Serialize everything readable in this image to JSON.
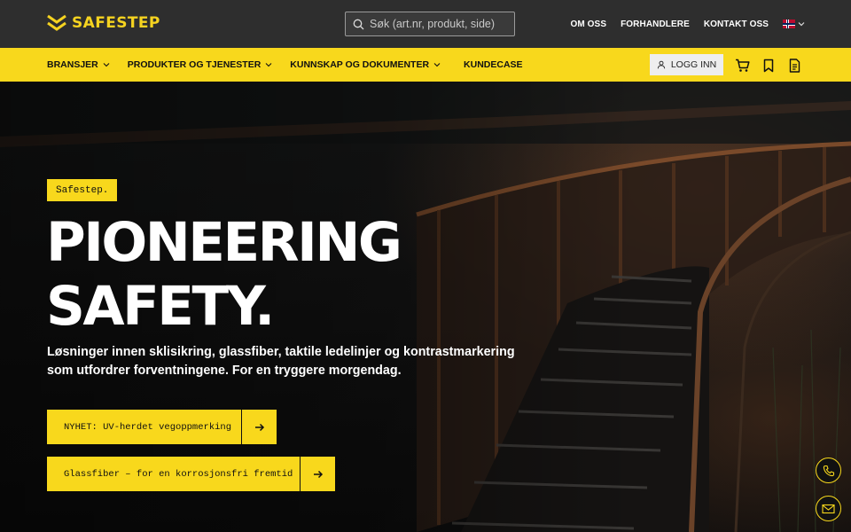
{
  "header": {
    "logo_text": "SAFESTEP",
    "search_placeholder": "Søk (art.nr, produkt, side)",
    "links": [
      "OM OSS",
      "FORHANDLERE",
      "KONTAKT OSS"
    ],
    "language_flag": "norway-flag-icon"
  },
  "nav": {
    "items": [
      {
        "label": "BRANSJER",
        "dropdown": true
      },
      {
        "label": "PRODUKTER OG TJENESTER",
        "dropdown": true
      },
      {
        "label": "KUNNSKAP OG DOKUMENTER",
        "dropdown": true
      },
      {
        "label": "KUNDECASE",
        "dropdown": false
      }
    ],
    "login_label": "LOGG INN",
    "icons": [
      "cart-icon",
      "bookmark-icon",
      "document-icon"
    ]
  },
  "hero": {
    "tag": "Safestep.",
    "headline_line1": "PIONEERING",
    "headline_line2": "SAFETY.",
    "subtitle": "Løsninger innen sklisikring, glassfiber, taktile ledelinjer og kontrastmarkering som utfordrer forventningene. For en tryggere morgendag.",
    "cta_primary": "NYHET: UV-herdet vegoppmerking",
    "cta_secondary": "Glassfiber – for en korrosjonsfri fremtid"
  },
  "floating": [
    "phone-icon",
    "mail-icon"
  ],
  "colors": {
    "brand_yellow": "#f8d81c",
    "topbar_bg": "#2e2e2e"
  }
}
